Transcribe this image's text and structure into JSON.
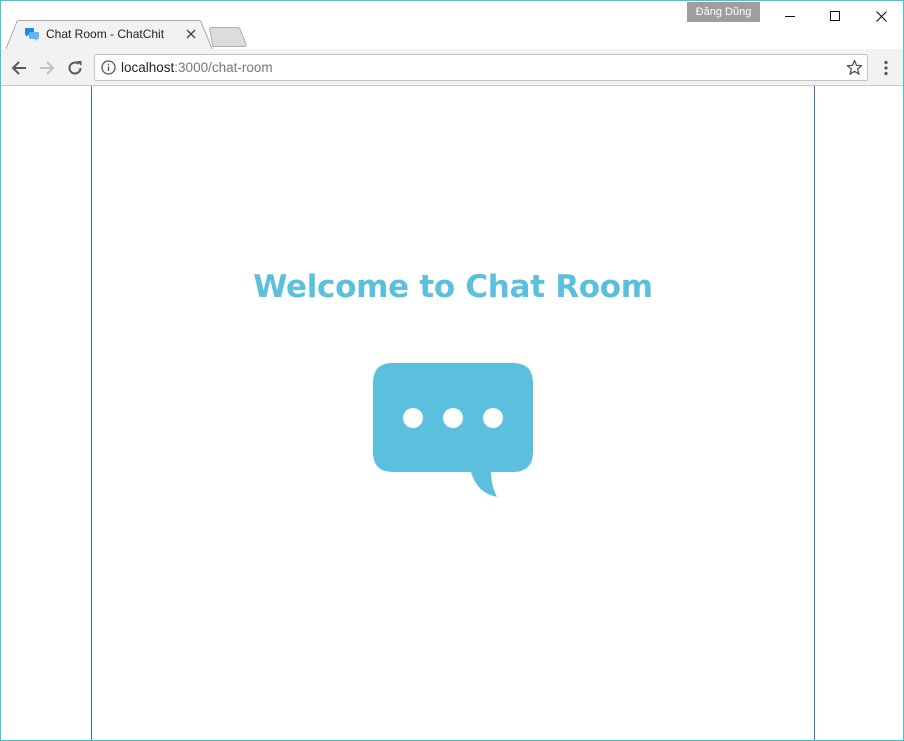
{
  "window": {
    "profile_name": "Đăng Dũng",
    "controls": [
      "minimize-icon",
      "maximize-icon",
      "close-icon"
    ]
  },
  "tabs": [
    {
      "title": "Chat Room - ChatChit",
      "favicon": "chat-bubbles-icon",
      "active": true
    }
  ],
  "toolbar": {
    "back_icon": "arrow-left-icon",
    "forward_icon": "arrow-right-icon",
    "reload_icon": "reload-icon",
    "url_host": "localhost",
    "url_rest": ":3000/chat-room",
    "star_icon": "star-icon",
    "menu_icon": "kebab-menu-icon"
  },
  "page": {
    "heading": "Welcome to Chat Room",
    "hero_icon": "chat-bubble-icon",
    "accent_color": "#5bc0de",
    "container_border_color": "#3a6fb0"
  }
}
